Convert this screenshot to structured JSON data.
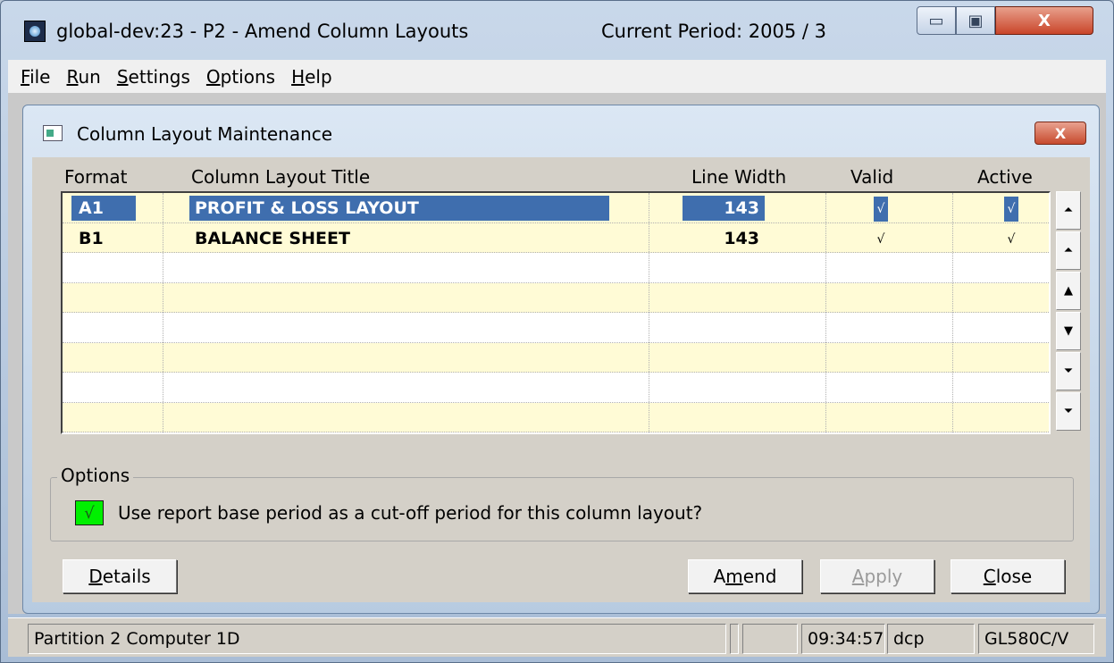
{
  "window": {
    "title": "global-dev:23 - P2 - Amend Column Layouts",
    "current_period": "Current Period: 2005    / 3",
    "min_glyph": "▭",
    "max_glyph": "▣",
    "close_glyph": "X"
  },
  "menu": [
    {
      "ul": "F",
      "rest": "ile"
    },
    {
      "ul": "R",
      "rest": "un"
    },
    {
      "ul": "S",
      "rest": "ettings"
    },
    {
      "ul": "O",
      "rest": "ptions"
    },
    {
      "ul": "H",
      "rest": "elp"
    }
  ],
  "dialog": {
    "title": "Column Layout Maintenance",
    "close_glyph": "X"
  },
  "grid": {
    "headers": {
      "format": "Format",
      "title": "Column Layout Title",
      "line_width": "Line Width",
      "valid": "Valid",
      "active": "Active"
    },
    "rows": [
      {
        "format": "A1",
        "title": "PROFIT & LOSS LAYOUT",
        "line_width": "143",
        "valid": "√",
        "active": "√",
        "selected": true
      },
      {
        "format": "B1",
        "title": "BALANCE SHEET",
        "line_width": "143",
        "valid": "√",
        "active": "√",
        "selected": false
      }
    ],
    "row_count": 8
  },
  "scroll": {
    "first": "⏶",
    "page_up": "⏶",
    "up": "▲",
    "down": "▼",
    "page_down": "⏷",
    "last": "⏷"
  },
  "options": {
    "legend": "Options",
    "cutoff_checked": true,
    "check_glyph": "√",
    "cutoff_label": "Use report base period as a cut-off period for this column layout?"
  },
  "buttons": {
    "details": {
      "ul": "D",
      "rest": "etails"
    },
    "amend": {
      "pre": "A",
      "ul": "m",
      "rest": "end"
    },
    "apply": {
      "ul": "A",
      "rest": "pply"
    },
    "close": {
      "ul": "C",
      "rest": "lose"
    }
  },
  "status": {
    "partition": "Partition 2 Computer 1D",
    "time": "09:34:57",
    "user": "dcp",
    "program": "GL580C/V"
  },
  "colors": {
    "selection": "#3f6eae",
    "row_alt": "#fffbd6",
    "checkbox": "#00f000"
  }
}
